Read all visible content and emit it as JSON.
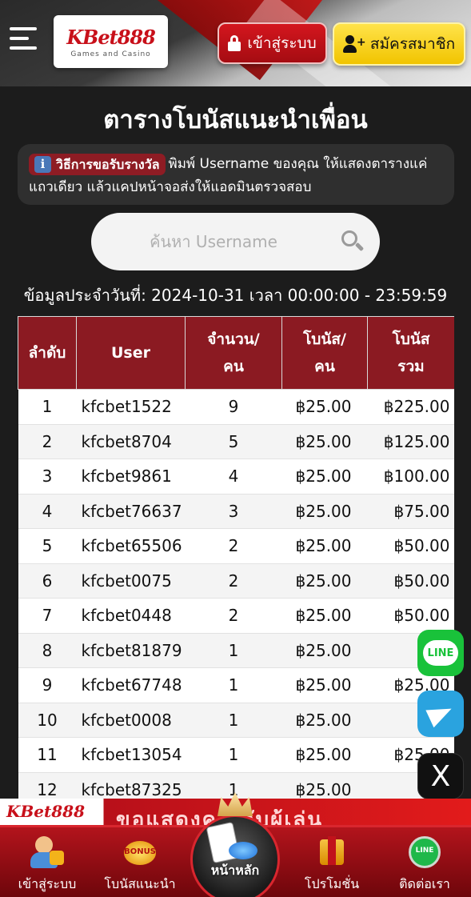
{
  "header": {
    "logo_brand": "KBet888",
    "logo_tagline": "Games and Casino",
    "login_label": "เข้าสู่ระบบ",
    "signup_label": "สมัครสมาชิก"
  },
  "page_title": "ตารางโบนัสแนะนำเพื่อน",
  "info": {
    "badge_label": "วิธีการขอรับรางวัล",
    "text": "พิมพ์ Username ของคุณ ให้แสดงตารางแค่แถวเดียว แล้วแคปหน้าจอส่งให้แอดมินตรวจสอบ"
  },
  "search": {
    "placeholder": "ค้นหา Username",
    "value": ""
  },
  "date_line": "ข้อมูลประจำวันที่: 2024-10-31 เวลา 00:00:00 - 23:59:59",
  "table": {
    "headers": [
      "ลำดับ",
      "User",
      "จำนวน/\nคน",
      "โบนัส/\nคน",
      "โบนัส\nรวม"
    ],
    "rows": [
      [
        "1",
        "kfcbet1522",
        "9",
        "฿25.00",
        "฿225.00"
      ],
      [
        "2",
        "kfcbet8704",
        "5",
        "฿25.00",
        "฿125.00"
      ],
      [
        "3",
        "kfcbet9861",
        "4",
        "฿25.00",
        "฿100.00"
      ],
      [
        "4",
        "kfcbet76637",
        "3",
        "฿25.00",
        "฿75.00"
      ],
      [
        "5",
        "kfcbet65506",
        "2",
        "฿25.00",
        "฿50.00"
      ],
      [
        "6",
        "kfcbet0075",
        "2",
        "฿25.00",
        "฿50.00"
      ],
      [
        "7",
        "kfcbet0448",
        "2",
        "฿25.00",
        "฿50.00"
      ],
      [
        "8",
        "kfcbet81879",
        "1",
        "฿25.00",
        "฿25"
      ],
      [
        "9",
        "kfcbet67748",
        "1",
        "฿25.00",
        "฿25.00"
      ],
      [
        "10",
        "kfcbet0008",
        "1",
        "฿25.00",
        "฿25"
      ],
      [
        "11",
        "kfcbet13054",
        "1",
        "฿25.00",
        "฿25.00"
      ],
      [
        "12",
        "kfcbet87325",
        "1",
        "฿25.00",
        "฿25"
      ]
    ]
  },
  "floating": {
    "line_label": "LINE",
    "x_label": "X"
  },
  "banner": {
    "logo": "KBet888",
    "text": "ขอแสดงค ดีกับผู้เล่น"
  },
  "bottom_nav": {
    "login": "เข้าสู่ระบบ",
    "bonus": "โบนัสแนะนำ",
    "bonus_icon_text": "BONUS",
    "home": "หน้าหลัก",
    "promo": "โปรโมชั่น",
    "contact": "ติดต่อเรา",
    "contact_icon_text": "LINE"
  },
  "colors": {
    "accent_red": "#8b1a22",
    "signup_yellow": "#f1c400",
    "background": "#1c1c1c"
  }
}
